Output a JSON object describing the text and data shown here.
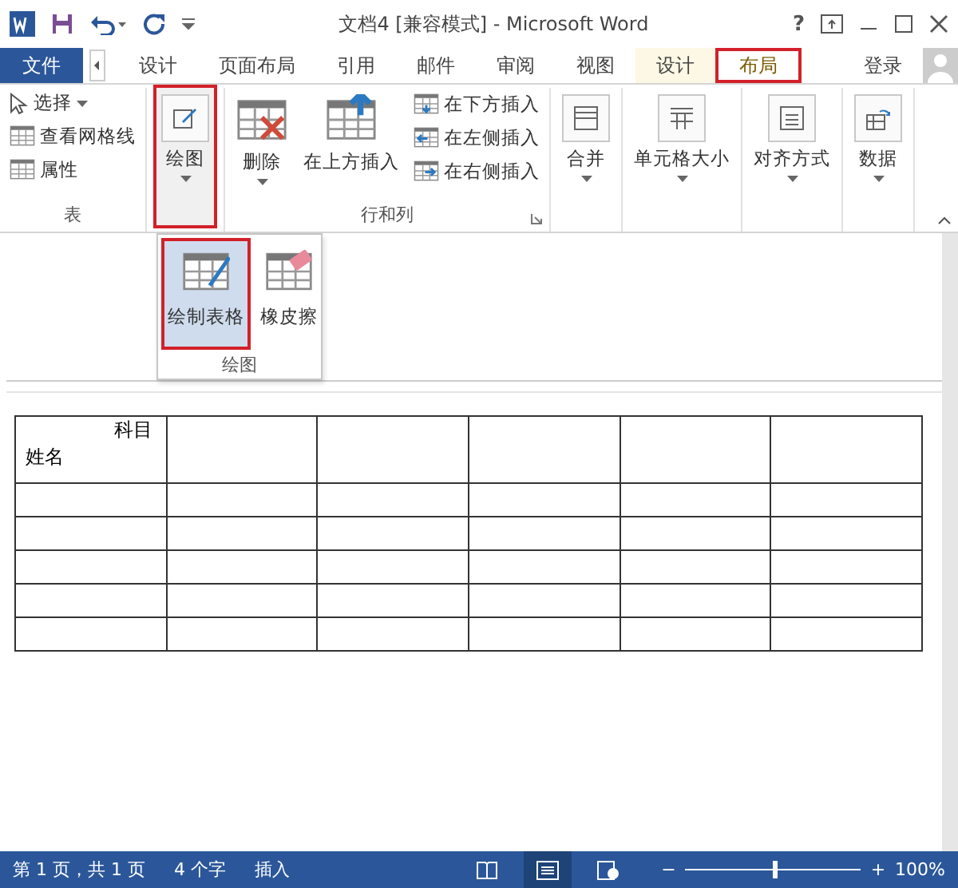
{
  "title_bar": {
    "title": "文档4 [兼容模式] - Microsoft Word",
    "help": "?"
  },
  "tabs": [
    {
      "label": "文件",
      "kind": "file",
      "selected": false,
      "outlined": false
    },
    {
      "label": "设计",
      "kind": "normal",
      "selected": false,
      "outlined": false
    },
    {
      "label": "页面布局",
      "kind": "normal",
      "selected": false,
      "outlined": false
    },
    {
      "label": "引用",
      "kind": "normal",
      "selected": false,
      "outlined": false
    },
    {
      "label": "邮件",
      "kind": "normal",
      "selected": false,
      "outlined": false
    },
    {
      "label": "审阅",
      "kind": "normal",
      "selected": false,
      "outlined": false
    },
    {
      "label": "视图",
      "kind": "normal",
      "selected": false,
      "outlined": false
    },
    {
      "label": "设计",
      "kind": "contextual",
      "selected": false,
      "outlined": false
    },
    {
      "label": "布局",
      "kind": "contextual",
      "selected": true,
      "outlined": true
    }
  ],
  "sign_in": "登录",
  "ribbon": [
    {
      "kind": "group",
      "label": "表",
      "controls": [
        {
          "kind": "small",
          "label": "选择",
          "caret": true
        },
        {
          "kind": "small",
          "label": "查看网格线",
          "caret": false
        },
        {
          "kind": "small",
          "label": "属性",
          "caret": false
        }
      ]
    },
    {
      "kind": "collapsed",
      "label": "绘图",
      "outlined": true
    },
    {
      "kind": "group",
      "label": "行和列",
      "launcher": true,
      "controls": [
        {
          "kind": "large",
          "label": "删除",
          "caret": true
        },
        {
          "kind": "large",
          "label": "在上方插入",
          "caret": false
        },
        {
          "kind": "small",
          "label": "在下方插入",
          "caret": false
        },
        {
          "kind": "small",
          "label": "在左侧插入",
          "caret": false
        },
        {
          "kind": "small",
          "label": "在右侧插入",
          "caret": false
        }
      ]
    },
    {
      "kind": "collapsed",
      "label": "合并",
      "outlined": false
    },
    {
      "kind": "collapsed",
      "label": "单元格大小",
      "outlined": false
    },
    {
      "kind": "collapsed",
      "label": "对齐方式",
      "outlined": false
    },
    {
      "kind": "collapsed",
      "label": "数据",
      "outlined": false
    }
  ],
  "dropdown": {
    "label": "绘图",
    "items": [
      {
        "label": "绘制表格",
        "selected": true,
        "outlined": true
      },
      {
        "label": "橡皮擦",
        "selected": false,
        "outlined": false
      }
    ]
  },
  "table": {
    "header_cell": {
      "top": "科目",
      "bottom": "姓名"
    }
  },
  "status_bar": {
    "items": [
      "第 1 页，共 1 页",
      "4 个字",
      "插入"
    ],
    "views": [
      {
        "selected": false
      },
      {
        "selected": true
      },
      {
        "selected": false
      }
    ],
    "zoom": {
      "minus": "−",
      "plus": "+",
      "level": 0.5,
      "reading": "100%"
    }
  }
}
